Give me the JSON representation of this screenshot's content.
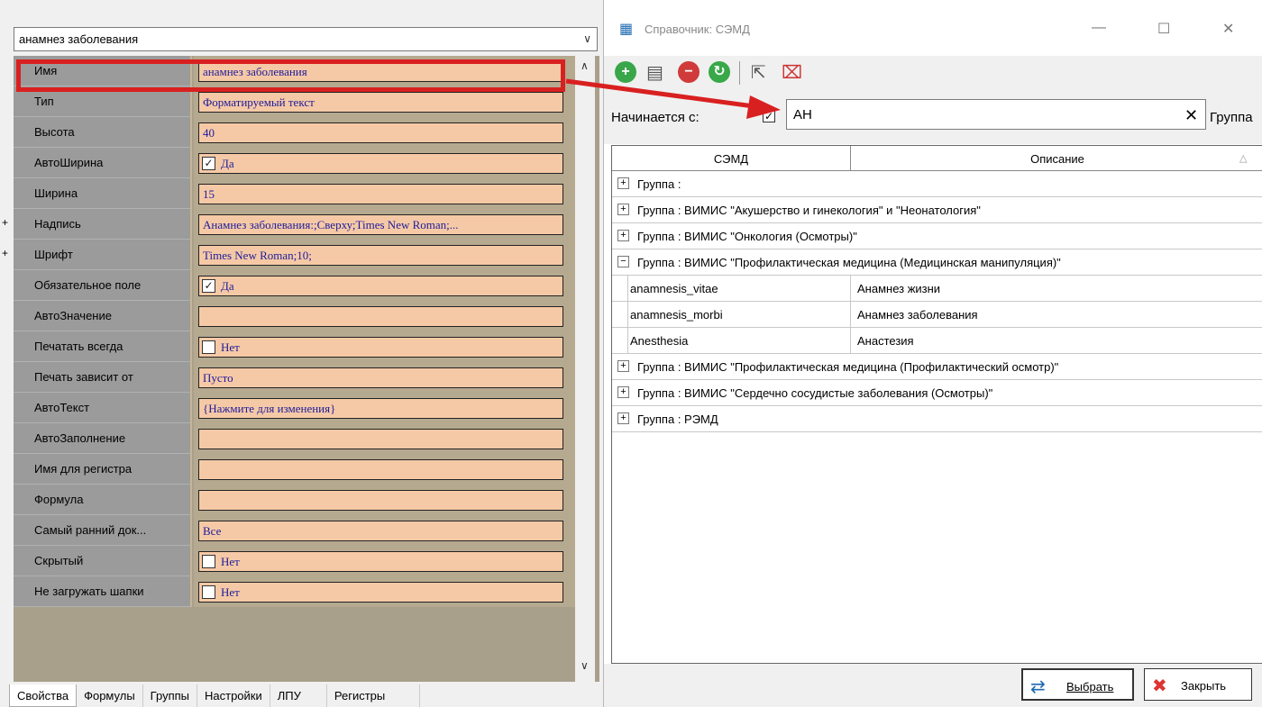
{
  "properties": {
    "selector_value": "анамнез заболевания",
    "rows": [
      {
        "name": "Имя",
        "value": "анамнез заболевания"
      },
      {
        "name": "Тип",
        "value": "Форматируемый текст"
      },
      {
        "name": "Высота",
        "value": "40"
      },
      {
        "name": "АвтоШирина",
        "value": "Да",
        "checked": true
      },
      {
        "name": "Ширина",
        "value": "15"
      },
      {
        "name": "Надпись",
        "value": "Анамнез заболевания:;Сверху;Times New Roman;...",
        "expandable": true
      },
      {
        "name": "Шрифт",
        "value": "Times New Roman;10;",
        "expandable": true
      },
      {
        "name": "Обязательное поле",
        "value": "Да",
        "checked": true
      },
      {
        "name": "АвтоЗначение",
        "value": ""
      },
      {
        "name": "Печатать всегда",
        "value": "Нет",
        "checked": false
      },
      {
        "name": "Печать зависит от",
        "value": "Пусто"
      },
      {
        "name": "АвтоТекст",
        "value": "{Нажмите для изменения}"
      },
      {
        "name": "АвтоЗаполнение",
        "value": ""
      },
      {
        "name": "Имя для регистра",
        "value": ""
      },
      {
        "name": "Формула",
        "value": ""
      },
      {
        "name": "Самый ранний док...",
        "value": "Все"
      },
      {
        "name": "Скрытый",
        "value": "Нет",
        "checked": false
      },
      {
        "name": "Не загружать шапки",
        "value": "Нет",
        "checked": false
      }
    ],
    "tabs": [
      "Свойства",
      "Формулы",
      "Группы",
      "Настройки",
      "ЛПУ",
      "Регистры"
    ]
  },
  "dialog": {
    "title": "Справочник: СЭМД",
    "filter_label": "Начинается с:",
    "filter_value": "АН",
    "filter_group_label": "Группа",
    "columns": [
      "СЭМД",
      "Описание"
    ],
    "groups": [
      {
        "label": "Группа :",
        "expanded": false
      },
      {
        "label": "Группа : ВИМИС \"Акушерство и гинекология\" и \"Неонатология\"",
        "expanded": false
      },
      {
        "label": "Группа : ВИМИС \"Онкология (Осмотры)\"",
        "expanded": false
      },
      {
        "label": "Группа : ВИМИС \"Профилактическая медицина (Медицинская манипуляция)\"",
        "expanded": true,
        "items": [
          {
            "code": "anamnesis_vitae",
            "description": "Анамнез жизни"
          },
          {
            "code": "anamnesis_morbi",
            "description": "Анамнез заболевания"
          },
          {
            "code": "Anesthesia",
            "description": "Анастезия"
          }
        ]
      },
      {
        "label": "Группа : ВИМИС \"Профилактическая медицина (Профилактический осмотр)\"",
        "expanded": false
      },
      {
        "label": "Группа : ВИМИС \"Сердечно сосудистые заболевания (Осмотры)\"",
        "expanded": false
      },
      {
        "label": "Группа : РЭМД",
        "expanded": false
      }
    ],
    "select_button": "Выбрать",
    "close_button": "Закрыть"
  },
  "colors": {
    "highlight": "#d92020",
    "value_cell": "#f6c9a6",
    "name_cell": "#9b9b9b",
    "value_text": "#1c1c9c"
  }
}
